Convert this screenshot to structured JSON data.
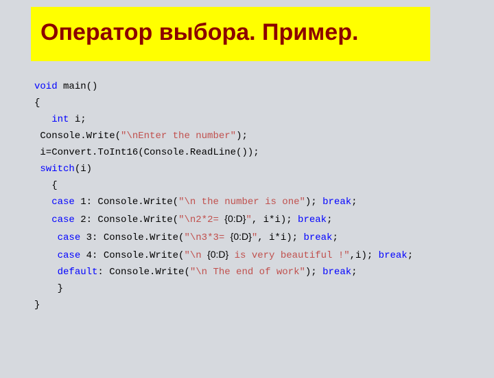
{
  "title": "Оператор выбора. Пример.",
  "code": {
    "l1_kw": "void",
    "l1_rest": " main()",
    "l2": "{",
    "l3_kw": "   int",
    "l3_rest": " i;",
    "l4_a": " Console.Write(",
    "l4_q": "\"",
    "l4_str": "\\nEnter the number\"",
    "l4_c": ");",
    "l5": " i=Convert.ToInt16(Console.ReadLine());",
    "l6_sp": " ",
    "l6_kw": "switch",
    "l6_rest": "(i)",
    "l7": "   {",
    "l8_sp": "   ",
    "l8_kw": "case",
    "l8_a": " 1: Console.Write(",
    "l8_q": "\"",
    "l8_str": "\\n the number is one\"",
    "l8_c": "); ",
    "l8_br": "break",
    "l8_sc": ";",
    "l9_sp": "   ",
    "l9_kw": "case",
    "l9_a": " 2: Console.Write(",
    "l9_q": "\"",
    "l9_str": "\\n2*2= ",
    "l9_fmt": "{0:D}",
    "l9_str2": "\"",
    "l9_c": ", i*i); ",
    "l9_br": "break",
    "l9_sc": ";",
    "l10_sp": "    ",
    "l10_kw": "case",
    "l10_a": " 3: Console.Write(",
    "l10_q": "\"",
    "l10_str": "\\n3*3= ",
    "l10_fmt": "{0:D}",
    "l10_str2": "\"",
    "l10_c": ", i*i); ",
    "l10_br": "break",
    "l10_sc": ";",
    "l11_sp": "    ",
    "l11_kw": "case",
    "l11_a": " 4: Console.Write(",
    "l11_q": "\"",
    "l11_str": "\\n ",
    "l11_fmt": "{0:D}",
    "l11_str2": " is very beautiful !\"",
    "l11_c": ",i); ",
    "l11_br": "break",
    "l11_sc": ";",
    "l12_sp": "    ",
    "l12_kw": "default",
    "l12_a": ": Console.Write(",
    "l12_q": "\"",
    "l12_str": "\\n The end of work\"",
    "l12_c": "); ",
    "l12_br": "break",
    "l12_sc": ";",
    "l13": "    }",
    "l14": "}"
  }
}
